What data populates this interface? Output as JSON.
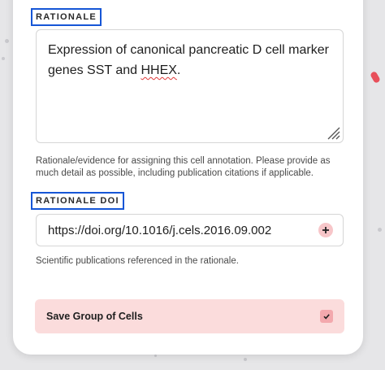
{
  "rationale": {
    "section_label": "RATIONALE",
    "text_before": "Expression of canonical pancreatic D cell marker genes SST and ",
    "text_flagged": "HHEX",
    "text_after": ".",
    "helper": "Rationale/evidence for assigning this cell annotation. Please provide as much detail as possible, including publication citations if applicable."
  },
  "rationale_doi": {
    "section_label": "RATIONALE DOI",
    "value": "https://doi.org/10.1016/j.cels.2016.09.002",
    "add_icon": "plus-circle-icon",
    "helper": "Scientific publications referenced in the rationale."
  },
  "save": {
    "label": "Save Group of Cells",
    "icon": "check-icon"
  },
  "colors": {
    "label_outline": "#1656d6",
    "save_bg": "#fbdcdc",
    "add_btn_bg": "#f7c6c9",
    "accent_red": "#e8505b"
  }
}
